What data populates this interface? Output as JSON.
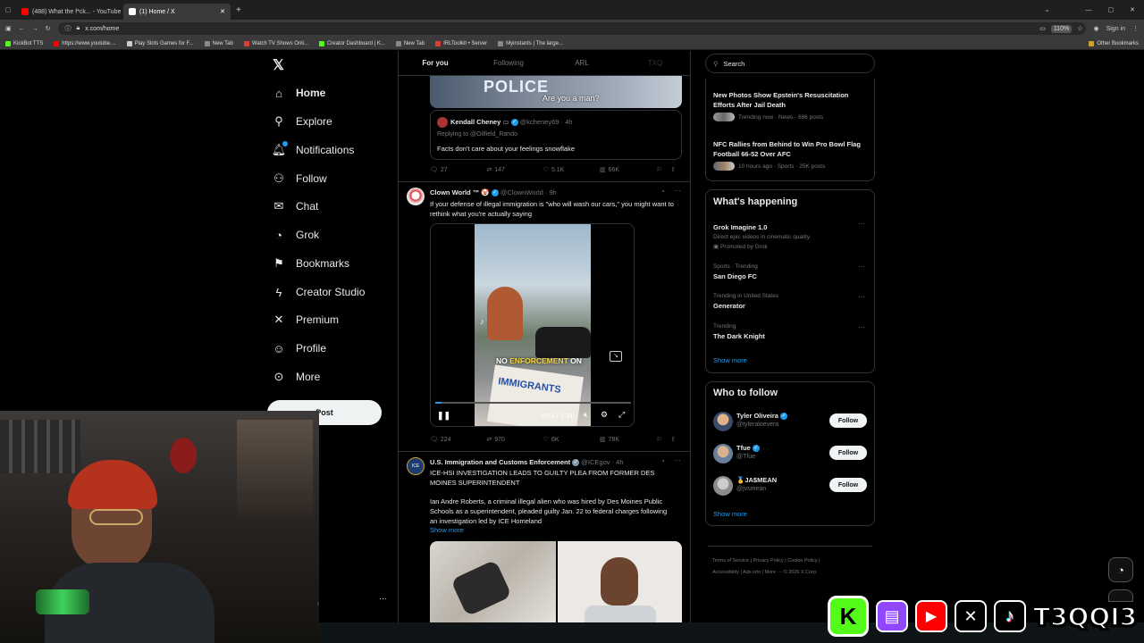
{
  "browser": {
    "tabs": [
      {
        "label": "(488) What the f*ck... - YouTube",
        "active": false,
        "color": "#ff0000"
      },
      {
        "label": "(1) Home / X",
        "active": true,
        "color": "#ffffff"
      }
    ],
    "url": "x.com/home",
    "zoom": "110%",
    "sign_in": "Sign in",
    "bookmarks": [
      "KickBot TTS",
      "https://www.youtube....",
      "Play Slots Games for F...",
      "New Tab",
      "Watch TV Shows Onli...",
      "Creator Dashboard | K...",
      "New Tab",
      "IRLToolkit • Server",
      "Myinstants | The large..."
    ],
    "other_bookmarks": "Other Bookmarks"
  },
  "nav": {
    "items": [
      {
        "label": "Home",
        "icon": "home-icon",
        "glyph": "⌂"
      },
      {
        "label": "Explore",
        "icon": "search-icon",
        "glyph": "⚲"
      },
      {
        "label": "Notifications",
        "icon": "bell-icon",
        "glyph": "♫"
      },
      {
        "label": "Follow",
        "icon": "person-plus-icon",
        "glyph": "👤"
      },
      {
        "label": "Chat",
        "icon": "mail-icon",
        "glyph": "✉"
      },
      {
        "label": "Grok",
        "icon": "grok-icon",
        "glyph": "◔"
      },
      {
        "label": "Bookmarks",
        "icon": "bookmark-icon",
        "glyph": "⚑"
      },
      {
        "label": "Creator Studio",
        "icon": "lightning-icon",
        "glyph": "⚡"
      },
      {
        "label": "Premium",
        "icon": "x-logo-icon",
        "glyph": "𝕏"
      },
      {
        "label": "Profile",
        "icon": "person-icon",
        "glyph": "☺"
      },
      {
        "label": "More",
        "icon": "more-icon",
        "glyph": "⋯"
      }
    ],
    "post_button": "Post"
  },
  "feed": {
    "tabs": [
      "For you",
      "Following",
      "ARL",
      "TXQ"
    ],
    "quoted": {
      "overlay": "POLICE",
      "caption": "Are you a man?",
      "reply_name": "Kendall Cheney",
      "reply_handle": "@kcheney69 · 4h",
      "replying_to": "Replying to @Oilfield_Rando",
      "reply_text": "Facts don't care about your feelings snowflake"
    },
    "post1_stats": {
      "replies": "27",
      "reposts": "147",
      "likes": "5.1K",
      "views": "66K"
    },
    "post2": {
      "name": "Clown World ™ 🤡",
      "handle": "@ClownWorld · 9h",
      "text": "If your defense of illegal immigration is \"who will wash our cars,\" you might want to rethink what you're actually saying",
      "video_caption_a": "NO",
      "video_caption_b": "ENFORCEMENT",
      "video_caption_c": "ON",
      "sign_text": "IMMIGRANTS",
      "time": "0:03 / 1:31",
      "progress": 0.03,
      "stats": {
        "replies": "224",
        "reposts": "970",
        "likes": "6K",
        "views": "78K"
      }
    },
    "post3": {
      "name": "U.S. Immigration and Customs Enforcement",
      "handle": "@ICEgov · 4h",
      "avatar_text": "ICE",
      "headline": "ICE-HSI INVESTIGATION LEADS TO GUILTY PLEA FROM FORMER DES MOINES SUPERINTENDENT",
      "body": "Ian Andre Roberts, a criminal illegal alien who was hired by Des Moines Public Schools as a superintendent, pleaded guilty Jan. 22 to federal charges following an investigation led by ICE Homeland",
      "show_more": "Show more"
    }
  },
  "right": {
    "search_placeholder": "Search",
    "news": [
      {
        "title": "New Photos Show Epstein's Resuscitation Efforts After Jail Death",
        "meta": "Trending now · News · 686 posts"
      },
      {
        "title": "NFC Rallies from Behind to Win Pro Bowl Flag Football 66-52 Over AFC",
        "meta": "10 hours ago · Sports · 25K posts"
      }
    ],
    "whats_happening": "What's happening",
    "trends": [
      {
        "meta": "",
        "name": "Grok Imagine 1.0",
        "sub": "Direct epic videos in cinematic quality.",
        "promo": "Promoted by Grok"
      },
      {
        "meta": "Sports · Trending",
        "name": "San Diego FC",
        "sub": "",
        "promo": ""
      },
      {
        "meta": "Trending in United States",
        "name": "Generator",
        "sub": "",
        "promo": ""
      },
      {
        "meta": "Trending",
        "name": "The Dark Knight",
        "sub": "",
        "promo": ""
      }
    ],
    "show_more": "Show more",
    "who_to_follow": "Who to follow",
    "follow_suggestions": [
      {
        "name": "Tyler Oliveira",
        "handle": "@tyleraloevera",
        "verified": true
      },
      {
        "name": "Tfue",
        "handle": "@Tfue",
        "verified": true
      },
      {
        "name": "🥇JA$MEAN",
        "handle": "@jvsmean",
        "verified": false
      }
    ],
    "follow_label": "Follow",
    "show_more_2": "Show more",
    "footer": [
      "Terms of Service",
      "Privacy Policy",
      "Cookie Policy",
      "Accessibility",
      "Ads info",
      "More ···",
      "© 2026 X Corp."
    ]
  },
  "overlay": {
    "channel": "T3QQI3",
    "socials": [
      "kick-icon",
      "twitch-icon",
      "youtube-icon",
      "x-icon",
      "tiktok-icon"
    ],
    "ticker": "alt"
  },
  "colors": {
    "accent": "#1d9bf0",
    "kick": "#53fc18",
    "twitch": "#9146ff",
    "youtube": "#ff0000"
  }
}
